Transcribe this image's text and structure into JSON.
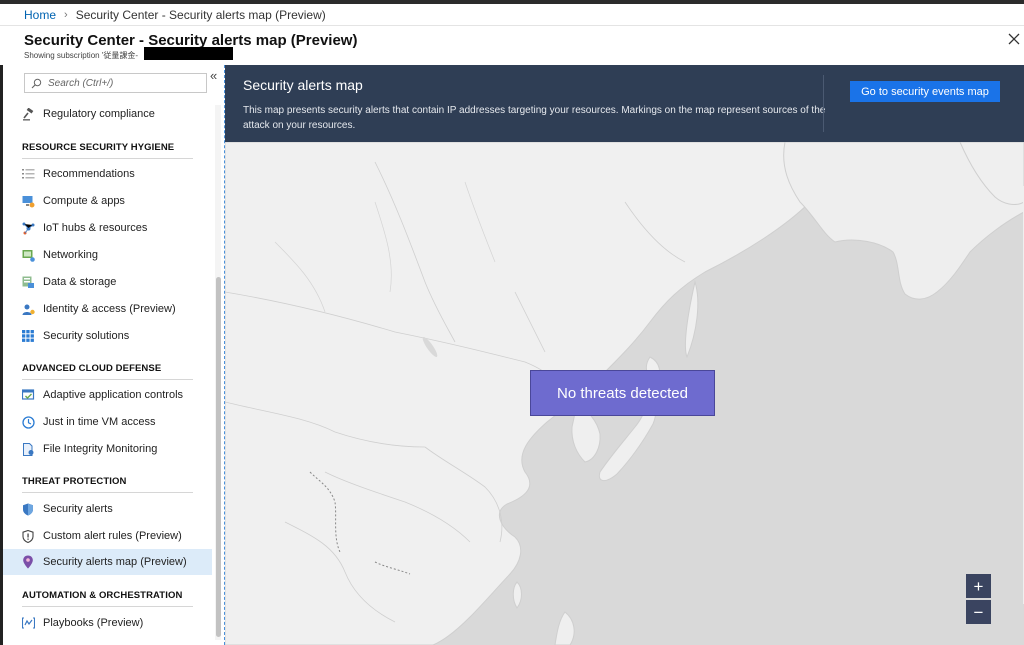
{
  "breadcrumb": {
    "home": "Home",
    "current": "Security Center - Security alerts map (Preview)"
  },
  "header": {
    "title": "Security Center - Security alerts map (Preview)",
    "subtitle": "Showing subscription '従量課金-"
  },
  "sidebar": {
    "search_placeholder": "Search (Ctrl+/)",
    "collapse_glyph": "«",
    "top_items": [
      {
        "label": "Regulatory compliance",
        "icon": "gavel-icon"
      }
    ],
    "sections": [
      {
        "title": "RESOURCE SECURITY HYGIENE",
        "items": [
          {
            "label": "Recommendations",
            "icon": "list-icon"
          },
          {
            "label": "Compute & apps",
            "icon": "compute-icon"
          },
          {
            "label": "IoT hubs & resources",
            "icon": "iot-icon"
          },
          {
            "label": "Networking",
            "icon": "network-icon"
          },
          {
            "label": "Data & storage",
            "icon": "database-icon"
          },
          {
            "label": "Identity & access (Preview)",
            "icon": "identity-icon"
          },
          {
            "label": "Security solutions",
            "icon": "grid-icon"
          }
        ]
      },
      {
        "title": "ADVANCED CLOUD DEFENSE",
        "items": [
          {
            "label": "Adaptive application controls",
            "icon": "app-control-icon"
          },
          {
            "label": "Just in time VM access",
            "icon": "clock-icon"
          },
          {
            "label": "File Integrity Monitoring",
            "icon": "file-icon"
          }
        ]
      },
      {
        "title": "THREAT PROTECTION",
        "items": [
          {
            "label": "Security alerts",
            "icon": "shield-icon"
          },
          {
            "label": "Custom alert rules (Preview)",
            "icon": "alert-rule-icon"
          },
          {
            "label": "Security alerts map (Preview)",
            "icon": "map-pin-icon",
            "active": true
          }
        ]
      },
      {
        "title": "AUTOMATION & ORCHESTRATION",
        "items": [
          {
            "label": "Playbooks (Preview)",
            "icon": "playbook-icon"
          }
        ]
      }
    ]
  },
  "map_panel": {
    "title": "Security alerts map",
    "description": "This map presents security alerts that contain IP addresses targeting your resources. Markings on the map represent sources of the attack on your resources.",
    "button_label": "Go to security events map",
    "status_overlay": "No threats detected",
    "zoom_in": "+",
    "zoom_out": "−"
  },
  "colors": {
    "accent": "#1a73e8",
    "header_bg": "#2f3e55",
    "overlay": "#6e6bcf",
    "land": "#f1f1f1",
    "sea": "#d8d8d8",
    "active_item": "#dcebf9"
  }
}
